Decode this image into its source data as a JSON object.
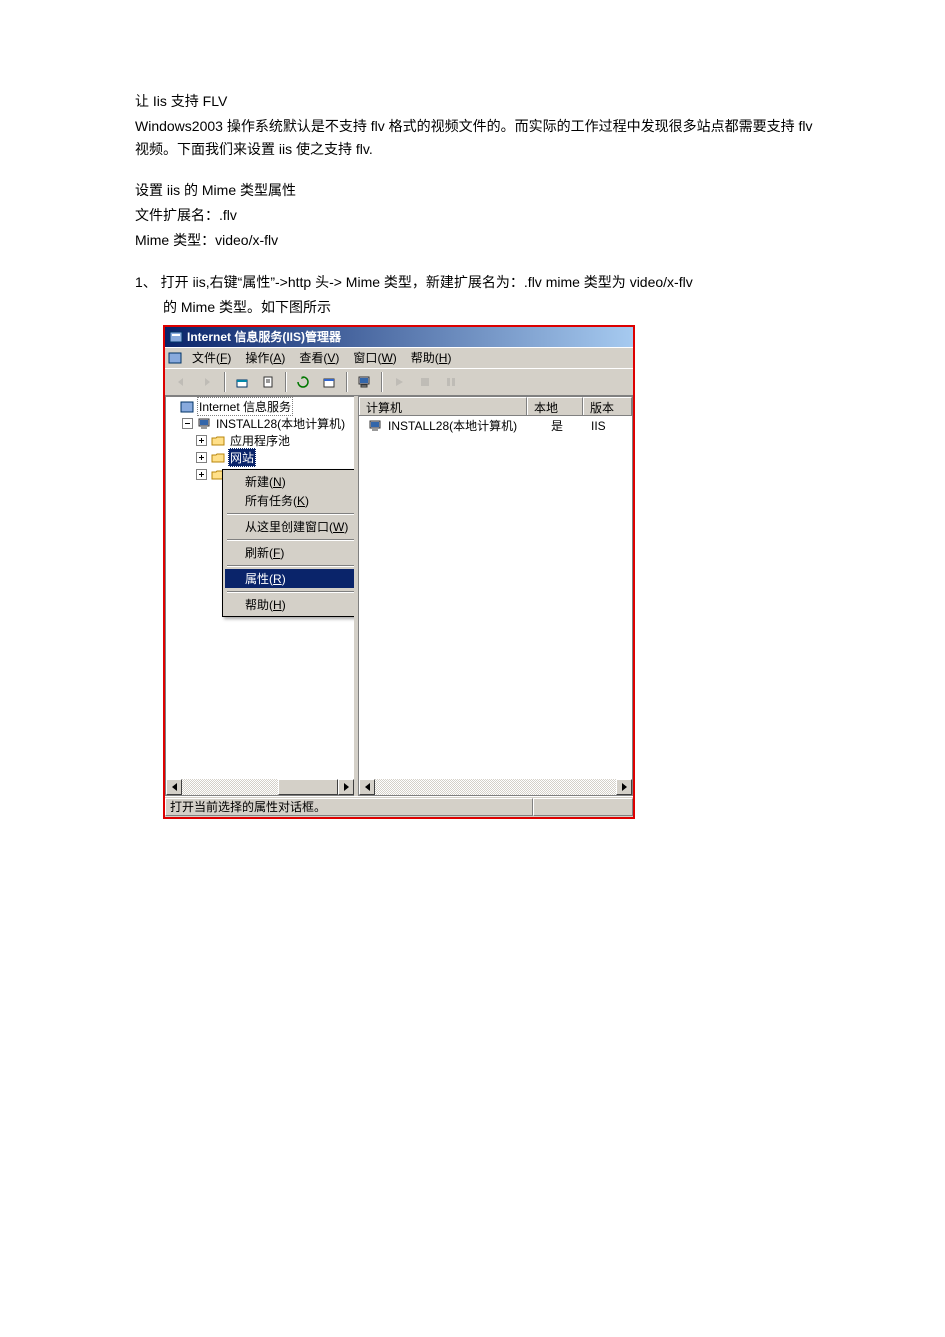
{
  "doc": {
    "title": "让 Iis 支持 FLV",
    "intro": "Windows2003 操作系统默认是不支持 flv 格式的视频文件的。而实际的工作过程中发现很多站点都需要支持 flv 视频。下面我们来设置 iis 使之支持 flv.",
    "mime_heading": "设置 iis 的 Mime  类型属性",
    "ext_line": "文件扩展名：.flv",
    "mime_line": "Mime  类型：video/x-flv",
    "step1_a": "1、 打开 iis,右键“属性”->http 头-> Mime  类型，新建扩展名为：.flv  mime 类型为 video/x-flv",
    "step1_b": "的 Mime  类型。如下图所示"
  },
  "iis": {
    "title": "Internet 信息服务(IIS)管理器",
    "menu": {
      "file": {
        "label": "文件",
        "mn": "F"
      },
      "action": {
        "label": "操作",
        "mn": "A"
      },
      "view": {
        "label": "查看",
        "mn": "V"
      },
      "window": {
        "label": "窗口",
        "mn": "W"
      },
      "help": {
        "label": "帮助",
        "mn": "H"
      }
    },
    "tree": {
      "root": "Internet 信息服务",
      "computer": "INSTALL28(本地计算机)",
      "app_pool": "应用程序池",
      "websites": "网站"
    },
    "list": {
      "cols": {
        "computer": "计算机",
        "local": "本地",
        "version": "版本"
      },
      "row": {
        "computer": "INSTALL28(本地计算机)",
        "local": "是",
        "version": "IIS"
      }
    },
    "ctx": {
      "new": "新建",
      "new_mn": "N",
      "alltasks": "所有任务",
      "alltasks_mn": "K",
      "newwin": "从这里创建窗口",
      "newwin_mn": "W",
      "refresh": "刷新",
      "refresh_mn": "F",
      "props": "属性",
      "props_mn": "R",
      "help": "帮助",
      "help_mn": "H"
    },
    "status": "打开当前选择的属性对话框。"
  }
}
